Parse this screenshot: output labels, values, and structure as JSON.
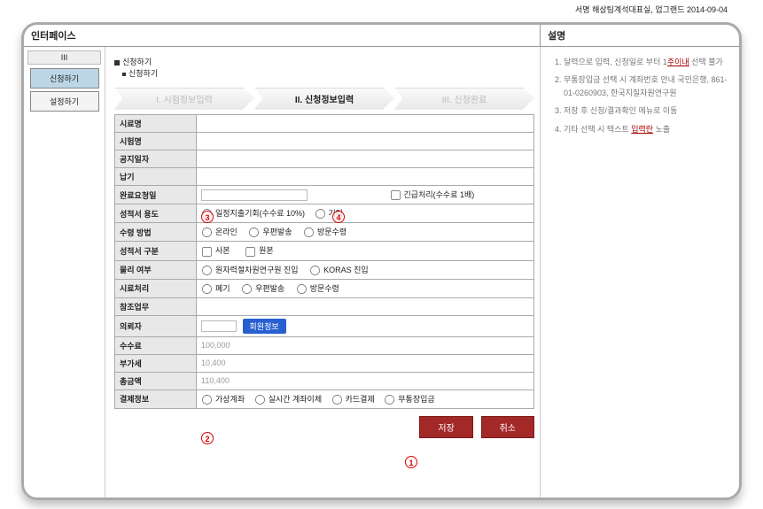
{
  "topbar": "서명  해상팀계석대표실,  업그랜드  2014-09-04",
  "heads": {
    "left": "인터페이스",
    "right": "설명"
  },
  "sidebar": {
    "tab": "III",
    "btn_blue": "신청하기",
    "btn_white": "설정하기"
  },
  "crumbs": {
    "a": "신청하기",
    "b": "신청하기"
  },
  "steps": {
    "s1": "I. 시험정보입력",
    "s2": "II. 신청정보입력",
    "s3": "III. 신청완료"
  },
  "markers": {
    "m1": "1",
    "m2": "2",
    "m3": "3",
    "m4": "4"
  },
  "form": {
    "r1": "시료명",
    "r2": "시험명",
    "r3": "공지일자",
    "r4": "납기",
    "r5_lab": "완료요청일",
    "r5_chk": "긴급처리(수수료 1배)",
    "r6_lab": "성적서 용도",
    "r6_rad1": "일정지출기회(수수료 10%)",
    "r6_rad2": "기타",
    "r7_lab": "수령 방법",
    "r7_a": "온라인",
    "r7_b": "우편발송",
    "r7_c": "방문수령",
    "r8_lab": "성적서 구분",
    "r8_a": "사본",
    "r8_b": "원본",
    "r9_lab": "물리 여부",
    "r9_a": "원자력절차원연구원 진입",
    "r9_b": "KORAS 진입",
    "r10_lab": "시료처리",
    "r10_a": "폐기",
    "r10_b": "우편발송",
    "r10_c": "방문수령",
    "r11_lab": "참조업무",
    "r12_lab": "의뢰자",
    "r12_btn": "회원정보",
    "r13_lab": "수수료",
    "r13_val": "100,000",
    "r14_lab": "부가세",
    "r14_val": "10,400",
    "r15_lab": "총금액",
    "r15_val": "110,400",
    "r16_lab": "결제정보",
    "r16_a": "가상계좌",
    "r16_b": "실시간 계좌이체",
    "r16_c": "카드결제",
    "r16_d": "무통장입금"
  },
  "actions": {
    "save": "저장",
    "cancel": "취소"
  },
  "desc": {
    "d1a": "달력으로 입력, 신청일로 부터 1",
    "d1b": "주이내",
    "d1c": " 선택 불가",
    "d2": "무통장입금 선택 시 계좌번호 안내 국민은행, 861-01-0260903, 한국지질자원연구원",
    "d3": "저장 후 신청/결과확인 메뉴로 이동",
    "d4a": "기타 선택 시 텍스트 ",
    "d4b": "입력란",
    "d4c": " 노출"
  },
  "chart_data": null
}
